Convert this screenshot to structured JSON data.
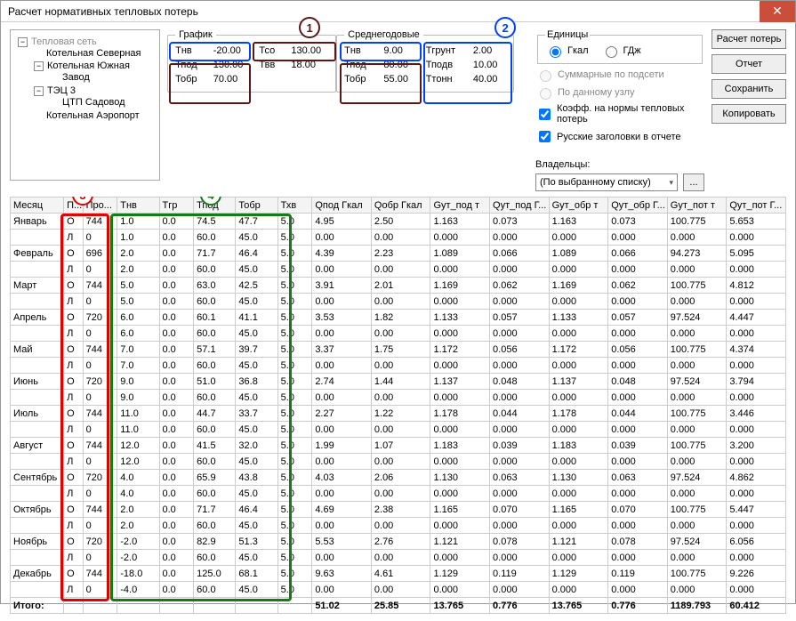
{
  "window": {
    "title": "Расчет нормативных тепловых потерь"
  },
  "tree": {
    "root": "Тепловая сеть",
    "n0": "Котельная Северная",
    "n1": "Котельная Южная",
    "n1a": "Завод",
    "n2": "ТЭЦ 3",
    "n2a": "ЦТП Садовод",
    "n3": "Котельная Аэропорт"
  },
  "grafik": {
    "legend": "График",
    "tnv_l": "Тнв",
    "tnv": "-20.00",
    "tso_l": "Тсо",
    "tso": "130.00",
    "tpod_l": "Тпод",
    "tpod": "130.00",
    "tvv_l": "Твв",
    "tvv": "18.00",
    "tobr_l": "Тобр",
    "tobr": "70.00"
  },
  "annual": {
    "legend": "Среднегодовые",
    "tnv_l": "Тнв",
    "tnv": "9.00",
    "tgr_l": "Тгрунт",
    "tgr": "2.00",
    "tpod_l": "Тпод",
    "tpod": "80.00",
    "tpodv_l": "Тподв",
    "tpodv": "10.00",
    "tobr_l": "Тобр",
    "tobr": "55.00",
    "ttonn_l": "Ттонн",
    "ttonn": "40.00"
  },
  "units": {
    "legend": "Единицы",
    "gkal": "Гкал",
    "gj": "ГДж"
  },
  "opts": {
    "sum": "Суммарные по подсети",
    "node": "По данному узлу",
    "coef": "Коэфф. на нормы тепловых потерь",
    "rus": "Русские заголовки в отчете"
  },
  "owners": {
    "label": "Владельцы:",
    "combo": "(По выбранному списку)"
  },
  "buttons": {
    "calc": "Расчет потерь",
    "rep": "Отчет",
    "save": "Сохранить",
    "copy": "Копировать"
  },
  "headers": [
    "Месяц",
    "П...",
    "Про...",
    "Тнв",
    "Тгр",
    "Тпод",
    "Тобр",
    "Тхв",
    "Qпод Гкал",
    "Qобр Гкал",
    "Gут_под т",
    "Qут_под Г...",
    "Gут_обр т",
    "Qут_обр Г...",
    "Gут_пот т",
    "Qут_пот Г..."
  ],
  "months": [
    "Январь",
    "Февраль",
    "Март",
    "Апрель",
    "Май",
    "Июнь",
    "Июль",
    "Август",
    "Сентябрь",
    "Октябрь",
    "Ноябрь",
    "Декабрь"
  ],
  "rows": [
    [
      "О",
      "744",
      "1.0",
      "0.0",
      "74.5",
      "47.7",
      "5.0",
      "4.95",
      "2.50",
      "1.163",
      "0.073",
      "1.163",
      "0.073",
      "100.775",
      "5.653"
    ],
    [
      "Л",
      "0",
      "1.0",
      "0.0",
      "60.0",
      "45.0",
      "5.0",
      "0.00",
      "0.00",
      "0.000",
      "0.000",
      "0.000",
      "0.000",
      "0.000",
      "0.000"
    ],
    [
      "О",
      "696",
      "2.0",
      "0.0",
      "71.7",
      "46.4",
      "5.0",
      "4.39",
      "2.23",
      "1.089",
      "0.066",
      "1.089",
      "0.066",
      "94.273",
      "5.095"
    ],
    [
      "Л",
      "0",
      "2.0",
      "0.0",
      "60.0",
      "45.0",
      "5.0",
      "0.00",
      "0.00",
      "0.000",
      "0.000",
      "0.000",
      "0.000",
      "0.000",
      "0.000"
    ],
    [
      "О",
      "744",
      "5.0",
      "0.0",
      "63.0",
      "42.5",
      "5.0",
      "3.91",
      "2.01",
      "1.169",
      "0.062",
      "1.169",
      "0.062",
      "100.775",
      "4.812"
    ],
    [
      "Л",
      "0",
      "5.0",
      "0.0",
      "60.0",
      "45.0",
      "5.0",
      "0.00",
      "0.00",
      "0.000",
      "0.000",
      "0.000",
      "0.000",
      "0.000",
      "0.000"
    ],
    [
      "О",
      "720",
      "6.0",
      "0.0",
      "60.1",
      "41.1",
      "5.0",
      "3.53",
      "1.82",
      "1.133",
      "0.057",
      "1.133",
      "0.057",
      "97.524",
      "4.447"
    ],
    [
      "Л",
      "0",
      "6.0",
      "0.0",
      "60.0",
      "45.0",
      "5.0",
      "0.00",
      "0.00",
      "0.000",
      "0.000",
      "0.000",
      "0.000",
      "0.000",
      "0.000"
    ],
    [
      "О",
      "744",
      "7.0",
      "0.0",
      "57.1",
      "39.7",
      "5.0",
      "3.37",
      "1.75",
      "1.172",
      "0.056",
      "1.172",
      "0.056",
      "100.775",
      "4.374"
    ],
    [
      "Л",
      "0",
      "7.0",
      "0.0",
      "60.0",
      "45.0",
      "5.0",
      "0.00",
      "0.00",
      "0.000",
      "0.000",
      "0.000",
      "0.000",
      "0.000",
      "0.000"
    ],
    [
      "О",
      "720",
      "9.0",
      "0.0",
      "51.0",
      "36.8",
      "5.0",
      "2.74",
      "1.44",
      "1.137",
      "0.048",
      "1.137",
      "0.048",
      "97.524",
      "3.794"
    ],
    [
      "Л",
      "0",
      "9.0",
      "0.0",
      "60.0",
      "45.0",
      "5.0",
      "0.00",
      "0.00",
      "0.000",
      "0.000",
      "0.000",
      "0.000",
      "0.000",
      "0.000"
    ],
    [
      "О",
      "744",
      "11.0",
      "0.0",
      "44.7",
      "33.7",
      "5.0",
      "2.27",
      "1.22",
      "1.178",
      "0.044",
      "1.178",
      "0.044",
      "100.775",
      "3.446"
    ],
    [
      "Л",
      "0",
      "11.0",
      "0.0",
      "60.0",
      "45.0",
      "5.0",
      "0.00",
      "0.00",
      "0.000",
      "0.000",
      "0.000",
      "0.000",
      "0.000",
      "0.000"
    ],
    [
      "О",
      "744",
      "12.0",
      "0.0",
      "41.5",
      "32.0",
      "5.0",
      "1.99",
      "1.07",
      "1.183",
      "0.039",
      "1.183",
      "0.039",
      "100.775",
      "3.200"
    ],
    [
      "Л",
      "0",
      "12.0",
      "0.0",
      "60.0",
      "45.0",
      "5.0",
      "0.00",
      "0.00",
      "0.000",
      "0.000",
      "0.000",
      "0.000",
      "0.000",
      "0.000"
    ],
    [
      "О",
      "720",
      "4.0",
      "0.0",
      "65.9",
      "43.8",
      "5.0",
      "4.03",
      "2.06",
      "1.130",
      "0.063",
      "1.130",
      "0.063",
      "97.524",
      "4.862"
    ],
    [
      "Л",
      "0",
      "4.0",
      "0.0",
      "60.0",
      "45.0",
      "5.0",
      "0.00",
      "0.00",
      "0.000",
      "0.000",
      "0.000",
      "0.000",
      "0.000",
      "0.000"
    ],
    [
      "О",
      "744",
      "2.0",
      "0.0",
      "71.7",
      "46.4",
      "5.0",
      "4.69",
      "2.38",
      "1.165",
      "0.070",
      "1.165",
      "0.070",
      "100.775",
      "5.447"
    ],
    [
      "Л",
      "0",
      "2.0",
      "0.0",
      "60.0",
      "45.0",
      "5.0",
      "0.00",
      "0.00",
      "0.000",
      "0.000",
      "0.000",
      "0.000",
      "0.000",
      "0.000"
    ],
    [
      "О",
      "720",
      "-2.0",
      "0.0",
      "82.9",
      "51.3",
      "5.0",
      "5.53",
      "2.76",
      "1.121",
      "0.078",
      "1.121",
      "0.078",
      "97.524",
      "6.056"
    ],
    [
      "Л",
      "0",
      "-2.0",
      "0.0",
      "60.0",
      "45.0",
      "5.0",
      "0.00",
      "0.00",
      "0.000",
      "0.000",
      "0.000",
      "0.000",
      "0.000",
      "0.000"
    ],
    [
      "О",
      "744",
      "-18.0",
      "0.0",
      "125.0",
      "68.1",
      "5.0",
      "9.63",
      "4.61",
      "1.129",
      "0.119",
      "1.129",
      "0.119",
      "100.775",
      "9.226"
    ],
    [
      "Л",
      "0",
      "-4.0",
      "0.0",
      "60.0",
      "45.0",
      "5.0",
      "0.00",
      "0.00",
      "0.000",
      "0.000",
      "0.000",
      "0.000",
      "0.000",
      "0.000"
    ]
  ],
  "total": {
    "label": "Итого:",
    "vals": [
      "",
      "",
      "",
      "",
      "",
      "",
      "",
      "51.02",
      "25.85",
      "13.765",
      "0.776",
      "13.765",
      "0.776",
      "1189.793",
      "60.412"
    ]
  }
}
